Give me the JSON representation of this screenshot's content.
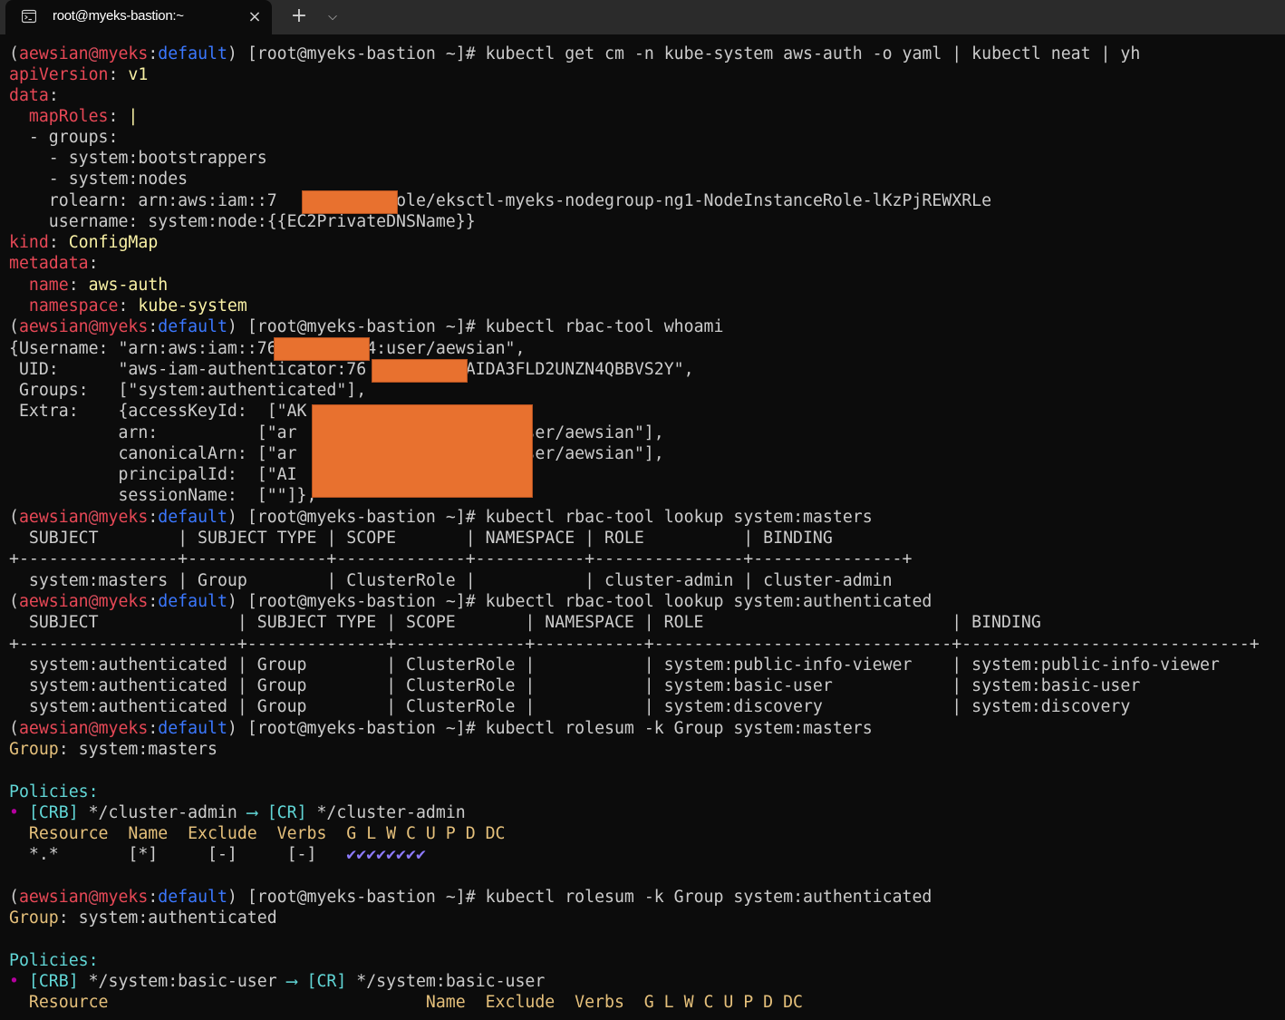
{
  "window": {
    "tab_title": "root@myeks-bastion:~",
    "tab_icon": "terminal-icon",
    "close_icon": "×",
    "new_tab_icon": "+",
    "dropdown_icon": "⌵"
  },
  "colors": {
    "background": "#0c0c0c",
    "text": "#cccccc",
    "user": "#e74856",
    "context": "#3b78ff",
    "yaml_key": "#e74856",
    "yaml_value": "#f9f1a5",
    "rolesum_label": "#e5c07b",
    "rolesum_section": "#61d6d6",
    "check": "#8e7bff",
    "redaction": "#e8712f"
  },
  "prompt": {
    "open": "(",
    "user": "aewsian",
    "at": "@",
    "host": "myeks",
    "colon": ":",
    "context": "default",
    "rest": ") [root@myeks-bastion ~]# "
  },
  "commands": {
    "c1": "kubectl get cm -n kube-system aws-auth -o yaml | kubectl neat | yh",
    "c2": "kubectl rbac-tool whoami",
    "c3": "kubectl rbac-tool lookup system:masters",
    "c4": "kubectl rbac-tool lookup system:authenticated",
    "c5": "kubectl rolesum -k Group system:masters",
    "c6": "kubectl rolesum -k Group system:authenticated"
  },
  "yaml": {
    "apiVersion_key": "apiVersion",
    "apiVersion_val": "v1",
    "data_key": "data",
    "mapRoles_key": "mapRoles",
    "mapRoles_val": "|",
    "l_groups": "  - groups:",
    "l_bootstrappers": "    - system:bootstrappers",
    "l_nodes": "    - system:nodes",
    "l_rolearn_a": "    rolearn: arn:aws:iam::7",
    "l_rolearn_b": "4:role/eksctl-myeks-nodegroup-ng1-NodeInstanceRole-lKzPjREWXRLe",
    "l_username": "    username: system:node:{{EC2PrivateDNSName}}",
    "kind_key": "kind",
    "kind_val": "ConfigMap",
    "metadata_key": "metadata",
    "name_key": "name",
    "name_val": "aws-auth",
    "namespace_key": "namespace",
    "namespace_val": "kube-system"
  },
  "whoami": [
    "{Username: \"arn:aws:iam::76",
    "4:user/aewsian\",",
    " UID:      \"aws-iam-authenticator:76",
    ":AIDA3FLD2UNZN4QBBVS2Y\",",
    " Groups:   [\"system:authenticated\"],",
    " Extra:    {accessKeyId:  [\"AK",
    "           arn:          [\"ar",
    "4:user/aewsian\"],",
    "           canonicalArn: [\"ar",
    "4:user/aewsian\"],",
    "           principalId:  [\"AI",
    "           sessionName:  [\"\"]},"
  ],
  "lookup_masters": {
    "header": "  SUBJECT        | SUBJECT TYPE | SCOPE       | NAMESPACE | ROLE          | BINDING",
    "separator": "+----------------+--------------+-------------+-----------+---------------+---------------+",
    "rows": [
      "  system:masters | Group        | ClusterRole |           | cluster-admin | cluster-admin"
    ]
  },
  "lookup_authenticated": {
    "header": "  SUBJECT              | SUBJECT TYPE | SCOPE       | NAMESPACE | ROLE                         | BINDING",
    "separator": "+----------------------+--------------+-------------+-----------+------------------------------+-----------------------------+",
    "rows": [
      "  system:authenticated | Group        | ClusterRole |           | system:public-info-viewer    | system:public-info-viewer",
      "  system:authenticated | Group        | ClusterRole |           | system:basic-user            | system:basic-user",
      "  system:authenticated | Group        | ClusterRole |           | system:discovery             | system:discovery"
    ]
  },
  "rolesum_masters": {
    "group_label": "Group",
    "group_value": " system:masters",
    "policies_label": "Policies:",
    "bullet": "•",
    "crb_tag": "[CRB]",
    "crb_name": " */cluster-admin ",
    "arrow": "⟶",
    "cr_tag": "[CR]",
    "cr_name": " */cluster-admin",
    "columns": "  Resource  Name  Exclude  Verbs  G L W C U P D DC",
    "row_prefix": "  *.*       [*]     [-]     [-]   ",
    "checks": "✔✔✔✔✔✔✔✔"
  },
  "rolesum_authenticated": {
    "group_label": "Group",
    "group_value": " system:authenticated",
    "policies_label": "Policies:",
    "bullet": "•",
    "crb_tag": "[CRB]",
    "crb_name": " */system:basic-user ",
    "arrow": "⟶",
    "cr_tag": "[CR]",
    "cr_name": " */system:basic-user",
    "columns": "  Resource                                Name  Exclude  Verbs  G L W C U P D DC"
  }
}
